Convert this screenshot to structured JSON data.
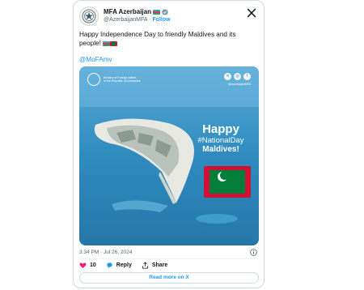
{
  "author": {
    "name": "MFA Azerbaijan",
    "handle": "@AzerbaijanMFA",
    "separator": "·",
    "follow_label": "Follow"
  },
  "tweet": {
    "text": "Happy Independence Day to friendly Maldives and its people!",
    "mention": "@MoFAmv",
    "timestamp": "3:34 PM · Jul 26, 2024"
  },
  "media": {
    "ministry_text": "Ministry of Foreign Affairs\nof the Republic of Azerbaijan",
    "social_handle": "@AzerbaijanMFA",
    "headline": "Happy",
    "hashtag": "#NationalDay",
    "country": "Maldives!"
  },
  "actions": {
    "like_count": "10",
    "reply_label": "Reply",
    "share_label": "Share",
    "read_more_label": "Read more on X"
  },
  "colors": {
    "accent": "#1d9bf0",
    "like": "#f91880",
    "verified_badge": "#829aab"
  },
  "icons": [
    "azerbaijan-seal-icon",
    "verified-badge-icon",
    "x-logo-icon",
    "info-icon",
    "heart-icon",
    "reply-icon",
    "share-icon",
    "facebook-icon",
    "instagram-icon"
  ]
}
